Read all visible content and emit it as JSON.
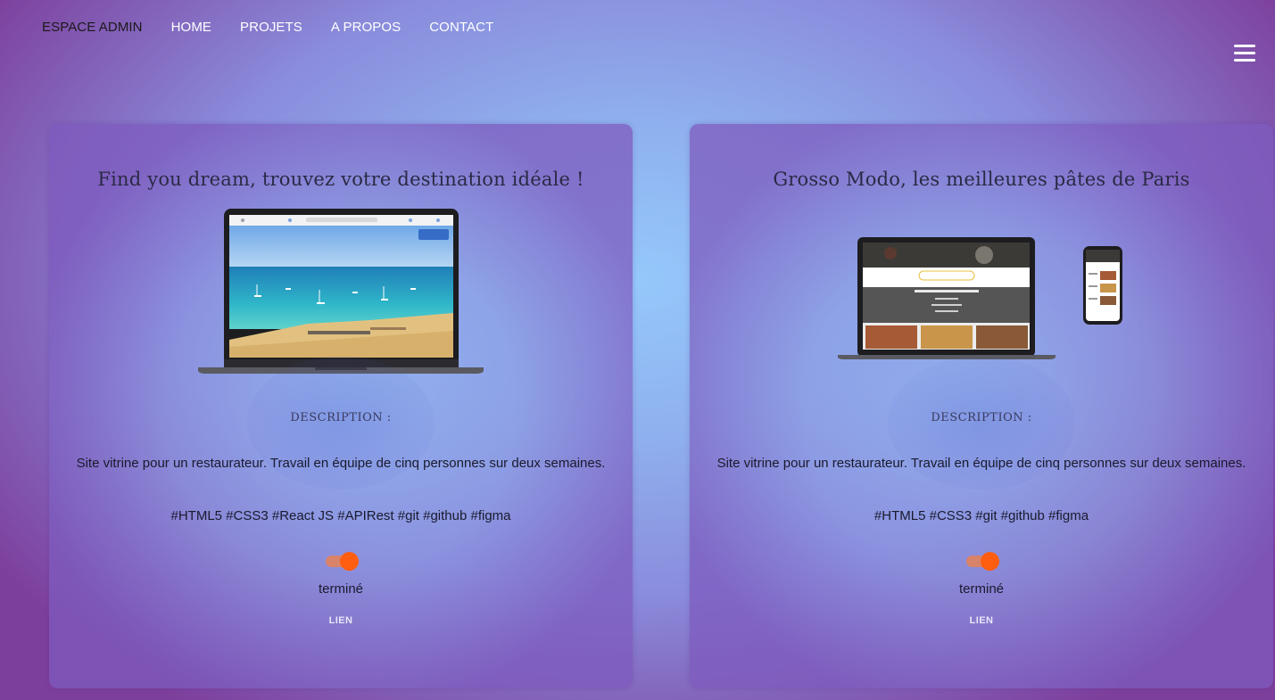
{
  "nav": {
    "admin": "ESPACE ADMIN",
    "home": "HOME",
    "projets": "PROJETS",
    "apropos": "A PROPOS",
    "contact": "CONTACT"
  },
  "projects": [
    {
      "title": "Find you dream, trouvez votre destination idéale !",
      "description_label": "DESCRIPTION :",
      "description": "Site vitrine pour un restaurateur. Travail en équipe de cinq personnes sur deux semaines.",
      "tags": "#HTML5 #CSS3 #React JS #APIRest #git #github #figma",
      "status": "terminé",
      "status_on": true,
      "link": "LIEN"
    },
    {
      "title": "Grosso Modo, les meilleures pâtes de Paris",
      "description_label": "DESCRIPTION :",
      "description": "Site vitrine pour un restaurateur. Travail en équipe de cinq personnes sur deux semaines.",
      "tags": "#HTML5 #CSS3 #git #github #figma",
      "status": "terminé",
      "status_on": true,
      "link": "LIEN"
    }
  ],
  "colors": {
    "toggle_knob": "#ff5e10",
    "toggle_track": "#d9836a"
  },
  "icons": {
    "menu": "hamburger-menu-icon"
  }
}
